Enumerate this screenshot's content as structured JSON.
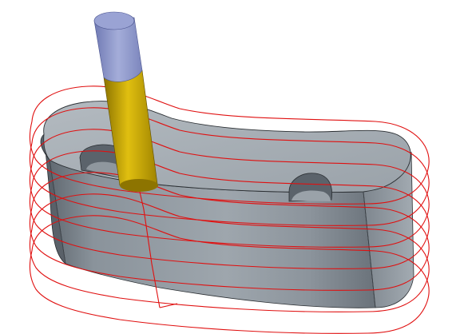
{
  "viewport": {
    "background": "#ffffff",
    "part": {
      "body_color": "#7e8790",
      "top_color": "#a9b1b8",
      "pocket_color": "#5b636b",
      "edge_color": "#2b2f33"
    },
    "tool": {
      "shank_color": "#8e98cc",
      "flute_color": "#c9a800"
    },
    "toolpath": {
      "color": "#e01010",
      "pass_count": 7
    }
  }
}
